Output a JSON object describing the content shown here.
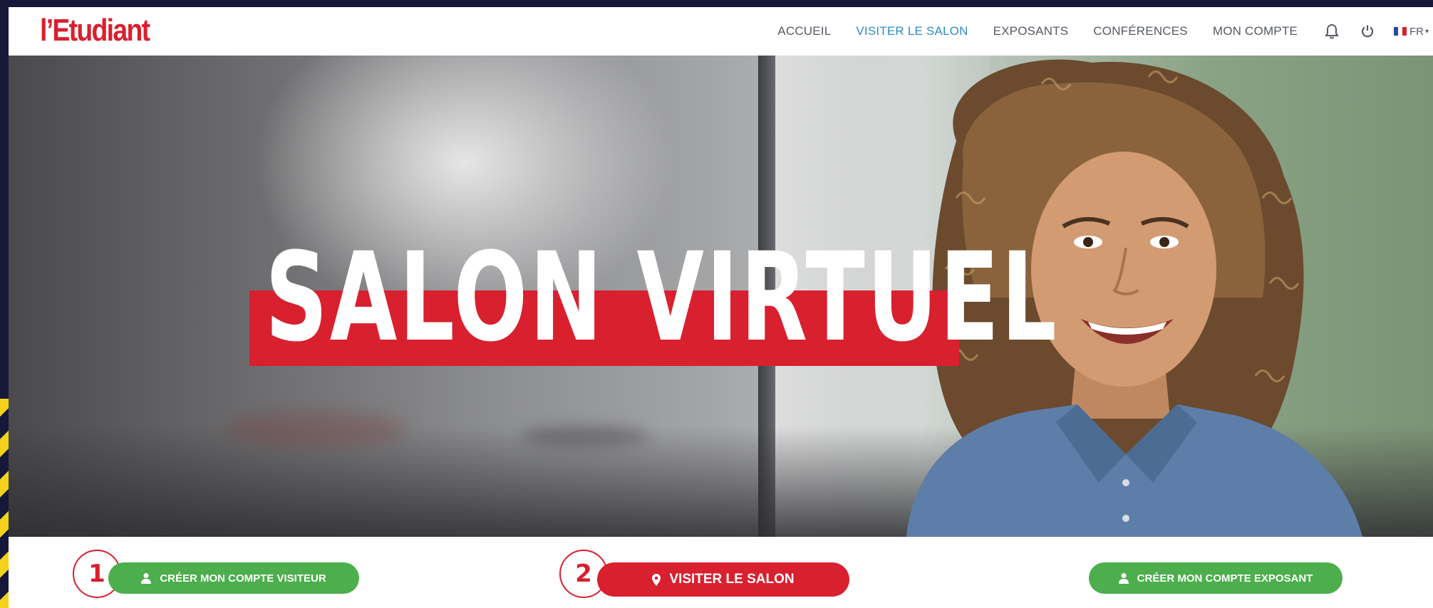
{
  "brand": {
    "logo_text": "l’Etudiant",
    "accent_color": "#d8202f",
    "link_active_color": "#2e8bc7",
    "green": "#4cae4c"
  },
  "nav": {
    "links": [
      "ACCUEIL",
      "VISITER LE SALON",
      "EXPOSANTS",
      "CONFÉRENCES",
      "MON COMPTE"
    ],
    "active_index": 1,
    "icons": [
      "bell-icon",
      "power-icon"
    ],
    "language": "FR"
  },
  "hero": {
    "title": "SALON VIRTUEL"
  },
  "actions": {
    "visitor_button": "CRÉER MON COMPTE VISITEUR",
    "visit_button": "VISITER LE SALON",
    "exhibitor_button": "CRÉER MON COMPTE EXPOSANT",
    "step_1": "1",
    "step_2": "2"
  }
}
